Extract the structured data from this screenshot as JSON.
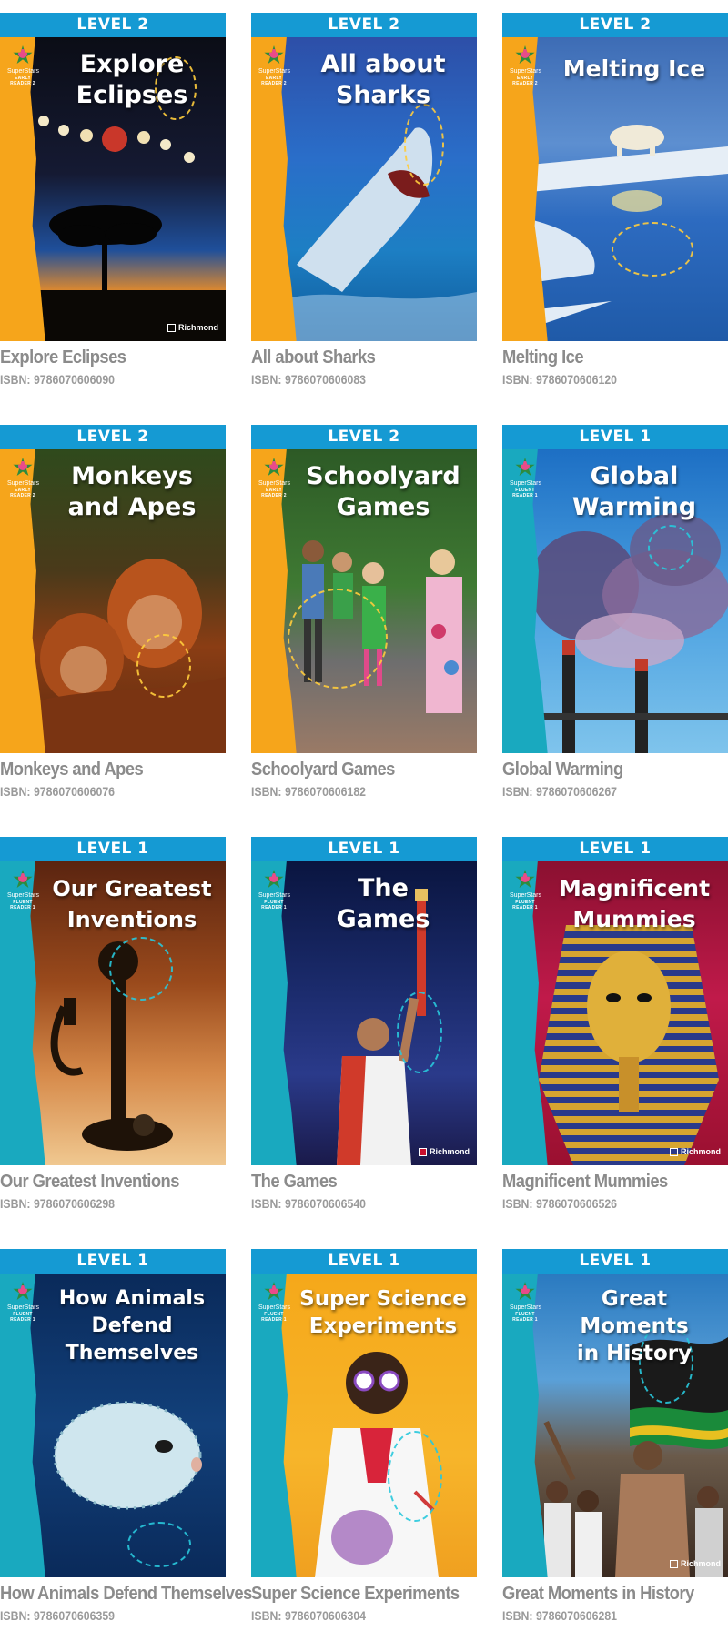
{
  "books": [
    {
      "level": "LEVEL 2",
      "cover_title_line1": "Explore",
      "cover_title_line2": "Eclipses",
      "title": "Explore Eclipses",
      "isbn": "ISBN: 9786070606090",
      "series": "SuperStars",
      "reader": "EARLY READER 2",
      "publisher": "Richmond"
    },
    {
      "level": "LEVEL 2",
      "cover_title_line1": "All about",
      "cover_title_line2": "Sharks",
      "title": "All about Sharks",
      "isbn": "ISBN: 9786070606083",
      "series": "SuperStars",
      "reader": "EARLY READER 2",
      "publisher": ""
    },
    {
      "level": "LEVEL 2",
      "cover_title_line1": "Melting Ice",
      "cover_title_line2": "",
      "title": "Melting Ice",
      "isbn": "ISBN: 9786070606120",
      "series": "SuperStars",
      "reader": "EARLY READER 2",
      "publisher": ""
    },
    {
      "level": "LEVEL 2",
      "cover_title_line1": "Monkeys",
      "cover_title_line2": "and Apes",
      "title": "Monkeys and Apes",
      "isbn": "ISBN: 9786070606076",
      "series": "SuperStars",
      "reader": "EARLY READER 2",
      "publisher": ""
    },
    {
      "level": "LEVEL 2",
      "cover_title_line1": "Schoolyard",
      "cover_title_line2": "Games",
      "title": "Schoolyard Games",
      "isbn": "ISBN: 9786070606182",
      "series": "SuperStars",
      "reader": "EARLY READER 2",
      "publisher": ""
    },
    {
      "level": "LEVEL 1",
      "cover_title_line1": "Global",
      "cover_title_line2": "Warming",
      "title": "Global Warming",
      "isbn": "ISBN: 9786070606267",
      "series": "SuperStars",
      "reader": "FLUENT READER 1",
      "publisher": ""
    },
    {
      "level": "LEVEL 1",
      "cover_title_line1": "Our Greatest",
      "cover_title_line2": "Inventions",
      "title": "Our Greatest Inventions",
      "isbn": "ISBN: 9786070606298",
      "series": "SuperStars",
      "reader": "FLUENT READER 1",
      "publisher": ""
    },
    {
      "level": "LEVEL 1",
      "cover_title_line1": "The",
      "cover_title_line2": "Games",
      "title": "The Games",
      "isbn": "ISBN: 9786070606540",
      "series": "SuperStars",
      "reader": "FLUENT READER 1",
      "publisher": "Richmond"
    },
    {
      "level": "LEVEL 1",
      "cover_title_line1": "Magnificent",
      "cover_title_line2": "Mummies",
      "title": "Magnificent Mummies",
      "isbn": "ISBN: 9786070606526",
      "series": "SuperStars",
      "reader": "FLUENT READER 1",
      "publisher": "Richmond"
    },
    {
      "level": "LEVEL 1",
      "cover_title_line1": "How Animals",
      "cover_title_line2": "Defend Themselves",
      "title": "How Animals Defend Themselves",
      "isbn": "ISBN: 9786070606359",
      "series": "SuperStars",
      "reader": "FLUENT READER 1",
      "publisher": ""
    },
    {
      "level": "LEVEL 1",
      "cover_title_line1": "Super Science",
      "cover_title_line2": "Experiments",
      "title": "Super Science Experiments",
      "isbn": "ISBN: 9786070606304",
      "series": "SuperStars",
      "reader": "FLUENT READER 1",
      "publisher": ""
    },
    {
      "level": "LEVEL 1",
      "cover_title_line1": "Great Moments",
      "cover_title_line2": "in History",
      "title": "Great Moments in History",
      "isbn": "ISBN: 9786070606281",
      "series": "SuperStars",
      "reader": "FLUENT READER 1",
      "publisher": "Richmond"
    }
  ],
  "colors": {
    "level_bar": "#159ad3",
    "level2_strip": "#f6a51b",
    "level1_strip": "#19a9bf",
    "caption_text": "#8b8b8b"
  }
}
